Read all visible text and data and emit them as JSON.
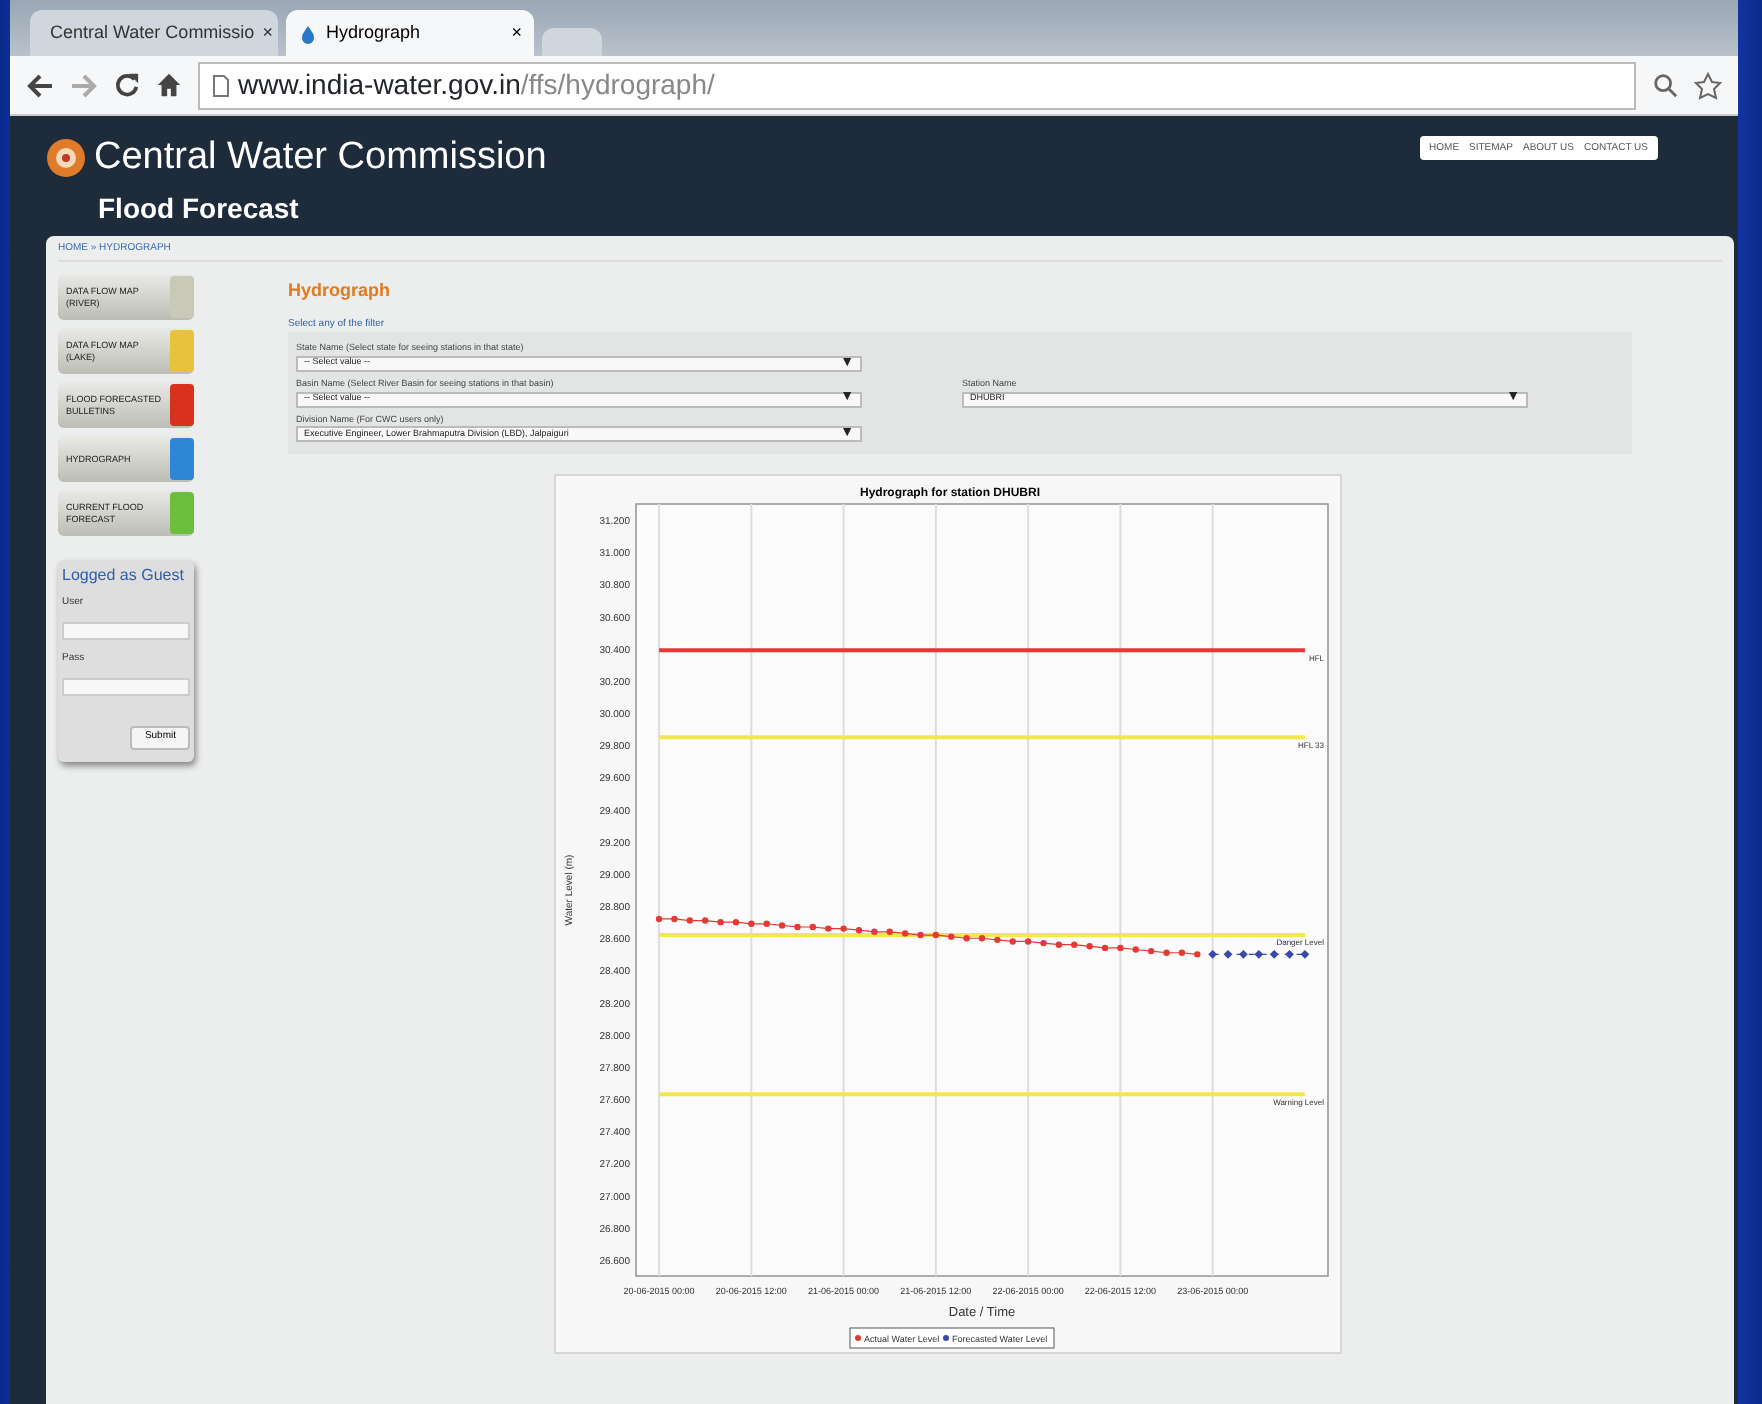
{
  "browser": {
    "tabs": [
      {
        "label": "Central Water Commissio",
        "close": "×",
        "selected": false
      },
      {
        "label": "Hydrograph",
        "close": "×",
        "selected": true
      }
    ],
    "address": {
      "host": "www.india-water.gov.in",
      "path": "/ffs/hydrograph/"
    }
  },
  "site": {
    "title": "Central Water Commission",
    "subtitle": "Flood Forecast",
    "top_links": [
      "HOME",
      "SITEMAP",
      "ABOUT US",
      "CONTACT US"
    ],
    "breadcrumb": "HOME » HYDROGRAPH"
  },
  "sidebar": {
    "items": [
      {
        "label": "DATA FLOW MAP (RIVER)",
        "color": "#c9c9b8"
      },
      {
        "label": "DATA FLOW MAP (LAKE)",
        "color": "#e8c23a"
      },
      {
        "label": "FLOOD FORECASTED BULLETINS",
        "color": "#d8321c"
      },
      {
        "label": "HYDROGRAPH",
        "color": "#2f86d6"
      },
      {
        "label": "CURRENT FLOOD FORECAST",
        "color": "#6cbf3c"
      }
    ]
  },
  "login": {
    "title": "Logged as Guest",
    "user_label": "User",
    "pass_label": "Pass",
    "submit": "Submit"
  },
  "main": {
    "heading": "Hydrograph",
    "filter_title": "Select any of the filter",
    "filters": [
      {
        "label": "State Name (Select state for seeing stations in that state)",
        "value": "-- Select value --",
        "caret": "▼"
      },
      {
        "label": "Basin Name (Select River Basin for seeing stations in that basin)",
        "value": "-- Select value --",
        "caret": "▼"
      },
      {
        "label": "Station Name",
        "value": "DHUBRI",
        "caret": "▼"
      },
      {
        "label": "Division Name (For CWC users only)",
        "value": "Executive Engineer, Lower Brahmaputra Division (LBD), Jalpaiguri",
        "caret": "▼"
      }
    ],
    "chart_data": {
      "type": "line",
      "grid": true,
      "legend": "bottom",
      "title": "Hydrograph for station DHUBRI",
      "xlabel": "Date / Time",
      "ylabel": "Water Level (m)",
      "categories": [
        "20-06-2015 00:00",
        null,
        null,
        null,
        null,
        null,
        "20-06-2015 12:00",
        null,
        null,
        null,
        null,
        null,
        "21-06-2015 00:00",
        null,
        null,
        null,
        null,
        null,
        "21-06-2015 12:00",
        null,
        null,
        null,
        null,
        null,
        "22-06-2015 00:00",
        null,
        null,
        null,
        null,
        null,
        "22-06-2015 12:00",
        null,
        null,
        null,
        null,
        null,
        "23-06-2015 00:00",
        null,
        null,
        null,
        null,
        null,
        null
      ],
      "series": [
        {
          "name": "Actual Water Level",
          "color": "#e53935",
          "marker": "circle",
          "values": [
            28.72,
            28.72,
            28.71,
            28.71,
            28.7,
            28.7,
            28.69,
            28.69,
            28.68,
            28.67,
            28.67,
            28.66,
            28.66,
            28.65,
            28.64,
            28.64,
            28.63,
            28.62,
            28.62,
            28.61,
            28.6,
            28.6,
            28.59,
            28.58,
            28.58,
            28.57,
            28.56,
            28.56,
            28.55,
            28.54,
            28.54,
            28.53,
            28.52,
            28.51,
            28.51,
            28.5,
            null,
            null,
            null,
            null,
            null,
            null,
            null
          ]
        },
        {
          "name": "Forecasted Water Level",
          "color": "#3949ab",
          "marker": "diamond",
          "line_style": "dashed",
          "values": [
            null,
            null,
            null,
            null,
            null,
            null,
            null,
            null,
            null,
            null,
            null,
            null,
            null,
            null,
            null,
            null,
            null,
            null,
            null,
            null,
            null,
            null,
            null,
            null,
            null,
            null,
            null,
            null,
            null,
            null,
            null,
            null,
            null,
            null,
            null,
            null,
            28.5,
            28.5,
            28.5,
            28.5,
            28.5,
            28.5,
            28.5
          ]
        },
        {
          "name": "HFL",
          "color": "#e53935",
          "values": [
            30.39,
            30.39,
            30.39,
            30.39,
            30.39,
            30.39,
            30.39,
            30.39,
            30.39,
            30.39,
            30.39,
            30.39,
            30.39,
            30.39,
            30.39,
            30.39,
            30.39,
            30.39,
            30.39,
            30.39,
            30.39,
            30.39,
            30.39,
            30.39,
            30.39,
            30.39,
            30.39,
            30.39,
            30.39,
            30.39,
            30.39,
            30.39,
            30.39,
            30.39,
            30.39,
            30.39,
            30.39,
            30.39,
            30.39,
            30.39,
            30.39,
            30.39,
            30.39
          ]
        },
        {
          "name": "HFL 33",
          "color": "#f2e84a",
          "values": [
            29.85,
            29.85,
            29.85,
            29.85,
            29.85,
            29.85,
            29.85,
            29.85,
            29.85,
            29.85,
            29.85,
            29.85,
            29.85,
            29.85,
            29.85,
            29.85,
            29.85,
            29.85,
            29.85,
            29.85,
            29.85,
            29.85,
            29.85,
            29.85,
            29.85,
            29.85,
            29.85,
            29.85,
            29.85,
            29.85,
            29.85,
            29.85,
            29.85,
            29.85,
            29.85,
            29.85,
            29.85,
            29.85,
            29.85,
            29.85,
            29.85,
            29.85,
            29.85
          ]
        },
        {
          "name": "Danger Level",
          "color": "#f2e84a",
          "values": [
            28.62,
            28.62,
            28.62,
            28.62,
            28.62,
            28.62,
            28.62,
            28.62,
            28.62,
            28.62,
            28.62,
            28.62,
            28.62,
            28.62,
            28.62,
            28.62,
            28.62,
            28.62,
            28.62,
            28.62,
            28.62,
            28.62,
            28.62,
            28.62,
            28.62,
            28.62,
            28.62,
            28.62,
            28.62,
            28.62,
            28.62,
            28.62,
            28.62,
            28.62,
            28.62,
            28.62,
            28.62,
            28.62,
            28.62,
            28.62,
            28.62,
            28.62,
            28.62
          ]
        },
        {
          "name": "Warning Level",
          "color": "#f2e84a",
          "values": [
            27.63,
            27.63,
            27.63,
            27.63,
            27.63,
            27.63,
            27.63,
            27.63,
            27.63,
            27.63,
            27.63,
            27.63,
            27.63,
            27.63,
            27.63,
            27.63,
            27.63,
            27.63,
            27.63,
            27.63,
            27.63,
            27.63,
            27.63,
            27.63,
            27.63,
            27.63,
            27.63,
            27.63,
            27.63,
            27.63,
            27.63,
            27.63,
            27.63,
            27.63,
            27.63,
            27.63,
            27.63,
            27.63,
            27.63,
            27.63,
            27.63,
            27.63,
            27.63
          ]
        }
      ],
      "ylim": [
        26.5,
        31.3
      ],
      "yticks": [
        {
          "value": 26.6,
          "label": "26.600"
        },
        {
          "value": 26.8,
          "label": "26.800"
        },
        {
          "value": 27.0,
          "label": "27.000"
        },
        {
          "value": 27.2,
          "label": "27.200"
        },
        {
          "value": 27.4,
          "label": "27.400"
        },
        {
          "value": 27.6,
          "label": "27.600"
        },
        {
          "value": 27.8,
          "label": "27.800"
        },
        {
          "value": 28.0,
          "label": "28.000"
        },
        {
          "value": 28.2,
          "label": "28.200"
        },
        {
          "value": 28.4,
          "label": "28.400"
        },
        {
          "value": 28.6,
          "label": "28.600"
        },
        {
          "value": 28.8,
          "label": "28.800"
        },
        {
          "value": 29.0,
          "label": "29.000"
        },
        {
          "value": 29.2,
          "label": "29.200"
        },
        {
          "value": 29.4,
          "label": "29.400"
        },
        {
          "value": 29.6,
          "label": "29.600"
        },
        {
          "value": 29.8,
          "label": "29.800"
        },
        {
          "value": 30.0,
          "label": "30.000"
        },
        {
          "value": 30.2,
          "label": "30.200"
        },
        {
          "value": 30.4,
          "label": "30.400"
        },
        {
          "value": 30.6,
          "label": "30.600"
        },
        {
          "value": 30.8,
          "label": "30.800"
        },
        {
          "value": 31.0,
          "label": "31.000"
        },
        {
          "value": 31.2,
          "label": "31.200"
        }
      ]
    }
  }
}
